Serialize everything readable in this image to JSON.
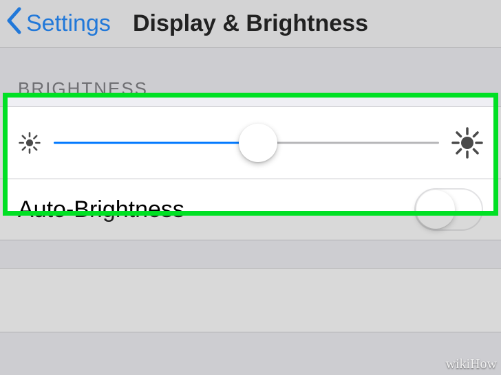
{
  "nav": {
    "back_label": "Settings",
    "title": "Display & Brightness"
  },
  "brightness": {
    "header": "BRIGHTNESS",
    "value_percent": 53
  },
  "auto": {
    "label": "Auto-Brightness",
    "enabled": false
  },
  "watermark": "wikiHow",
  "colors": {
    "accent": "#0079ff",
    "highlight": "#00e024"
  }
}
